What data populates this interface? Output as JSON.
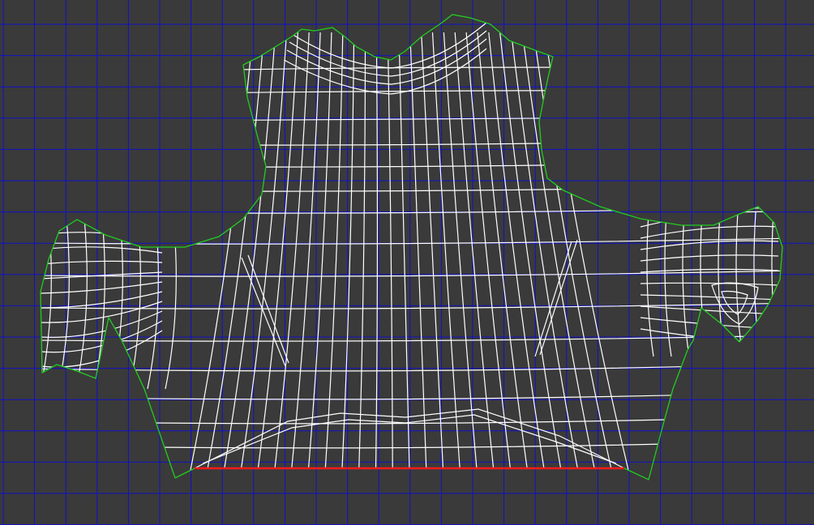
{
  "viewport": {
    "background_color": "#3a3a3a",
    "grid_color": "#1010c8",
    "mesh_line_color": "#ffffff",
    "boundary_color": "#22cc22",
    "selected_edge_color": "#ff1a1a"
  }
}
